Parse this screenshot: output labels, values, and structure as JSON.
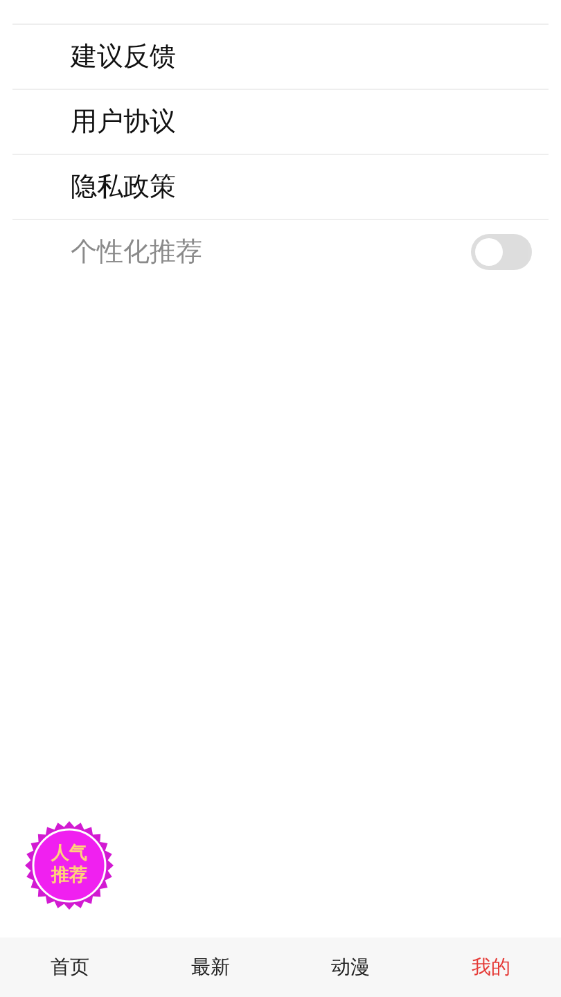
{
  "menu": [
    {
      "kind": "link",
      "label": "建议反馈",
      "disabled": false
    },
    {
      "kind": "link",
      "label": "用户协议",
      "disabled": false
    },
    {
      "kind": "link",
      "label": "隐私政策",
      "disabled": false
    },
    {
      "kind": "toggle",
      "label": "个性化推荐",
      "disabled": true,
      "on": false
    }
  ],
  "floating_badge": {
    "lines": [
      "人气",
      "推荐"
    ]
  },
  "tabs": [
    {
      "label": "首页",
      "selected": false
    },
    {
      "label": "最新",
      "selected": false
    },
    {
      "label": "动漫",
      "selected": false
    },
    {
      "label": "我的",
      "selected": true
    }
  ]
}
